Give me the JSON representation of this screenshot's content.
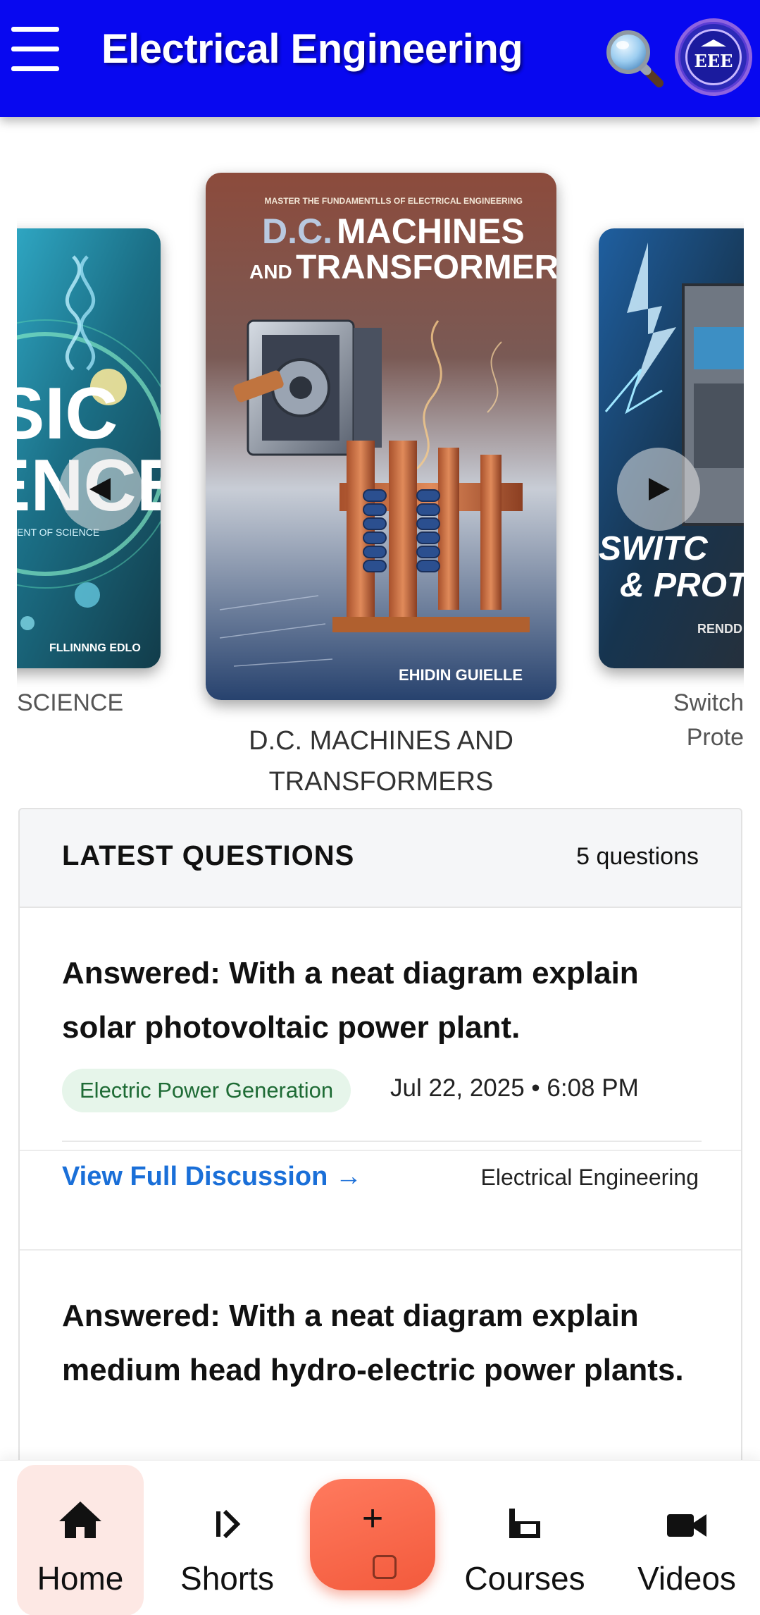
{
  "header": {
    "title": "Electrical Engineering",
    "profile_badge": "EEE",
    "menu_icon": "hamburger-icon",
    "search_icon": "magnifier-icon"
  },
  "carousel": {
    "books": [
      {
        "caption": "SCIENCE",
        "cover_text": [
          "SIC",
          "ENCE",
          "ENT OF SCIENCE",
          "FLLINNNG EDLO"
        ]
      },
      {
        "caption": "D.C. MACHINES AND TRANSFORMERS",
        "cover_tagline": "MASTER THE FUNDAMENTLLS OF ELECTRICAL ENGINEERING",
        "cover_title_1a": "D.C.",
        "cover_title_1b": "MACHINES",
        "cover_title_2a": "AND",
        "cover_title_2b": "TRANSFORMERS",
        "cover_author": "EHIDIN GUIELLE"
      },
      {
        "caption_line1": "Switch",
        "caption_line2": "Prote",
        "cover_text": [
          "SWITC",
          "& PROT",
          "RENDD"
        ]
      }
    ],
    "prev_icon": "play-left-icon",
    "next_icon": "play-right-icon"
  },
  "questions": {
    "title": "LATEST QUESTIONS",
    "count_label": "5 questions",
    "items": [
      {
        "title": "Answered: With a neat diagram explain solar photovoltaic power plant.",
        "tag": "Electric Power Generation",
        "date": "Jul 22, 2025 • 6:08 PM",
        "link": "View Full Discussion →",
        "source": "Electrical Engineering"
      },
      {
        "title": "Answered: With a neat diagram explain medium head hydro-electric power plants."
      }
    ]
  },
  "bottom_nav": {
    "items": [
      {
        "label": "Home",
        "icon": "home-icon",
        "active": true
      },
      {
        "label": "Shorts",
        "icon": "shorts-icon"
      },
      {
        "label": "Courses",
        "icon": "courses-icon"
      },
      {
        "label": "Videos",
        "icon": "video-camera-icon"
      }
    ],
    "fab_label": "+",
    "colors": {
      "active_bg": "#fde8e4",
      "fab": "#f35a3c"
    }
  },
  "colors": {
    "header_bg": "#0808f0",
    "link": "#1a6fd8",
    "tag_bg": "#e6f5ea",
    "tag_text": "#1e6b35"
  }
}
